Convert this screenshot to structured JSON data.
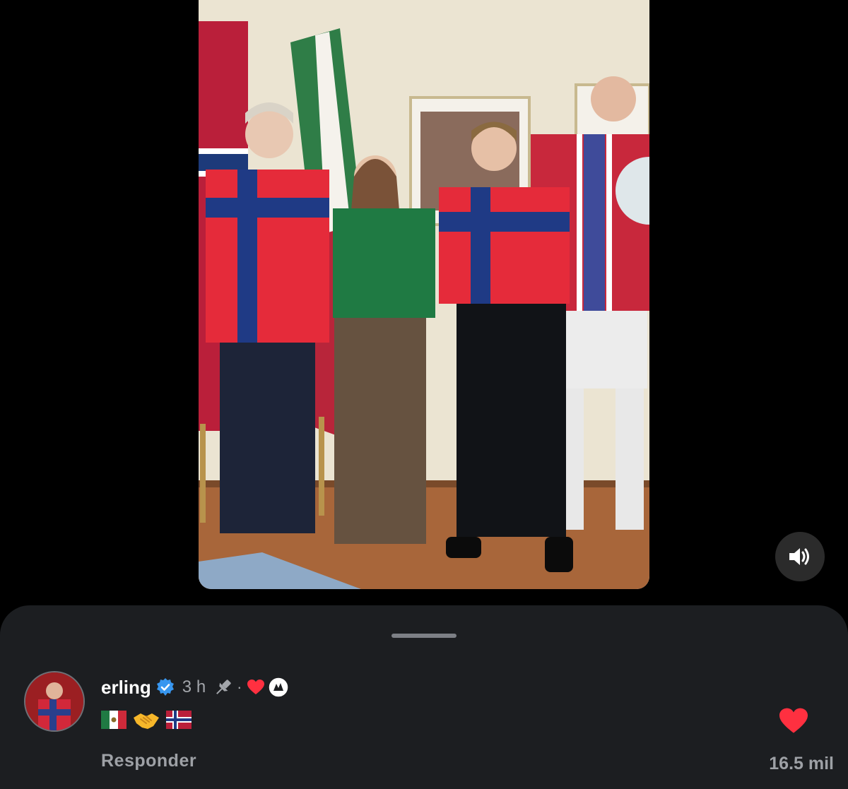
{
  "video": {
    "media": "embassy-jersey-video",
    "sound_icon": "speaker-icon"
  },
  "comment": {
    "username": "erling",
    "verified": true,
    "time": "3 h",
    "pinned_icon": "pin-icon",
    "separator": "·",
    "liked_by_author_icons": [
      "heart-icon",
      "creator-avatar-icon"
    ],
    "emoji_text": [
      "🇲🇽",
      "🤝",
      "🇳🇴"
    ],
    "reply_label": "Responder",
    "like_count": "16.5 mil"
  },
  "colors": {
    "background": "#000000",
    "sheet": "#1c1e21",
    "secondary_text": "#a3a6ab",
    "verified_blue": "#3897f0",
    "like_red": "#ff3040"
  }
}
